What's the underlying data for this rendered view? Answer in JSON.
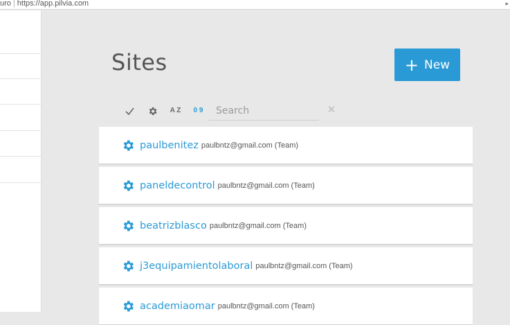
{
  "browser": {
    "url_prefix": "uro",
    "url": "https://app.pilvia.com"
  },
  "header": {
    "title": "Sites",
    "new_button_label": "New"
  },
  "toolbar": {
    "sort_az_label": "A Z",
    "sort_num_label": "0 9",
    "search_placeholder": "Search"
  },
  "sites": [
    {
      "name": "paulbenitez",
      "meta": "paulbntz@gmail.com (Team)"
    },
    {
      "name": "paneldecontrol",
      "meta": "paulbntz@gmail.com (Team)"
    },
    {
      "name": "beatrizblasco",
      "meta": "paulbntz@gmail.com (Team)"
    },
    {
      "name": "j3equipamientolaboral",
      "meta": "paulbntz@gmail.com (Team)"
    },
    {
      "name": "academiaomar",
      "meta": "paulbntz@gmail.com (Team)"
    }
  ],
  "colors": {
    "accent": "#2a9ad6",
    "background": "#e8e8e8",
    "card": "#ffffff"
  }
}
